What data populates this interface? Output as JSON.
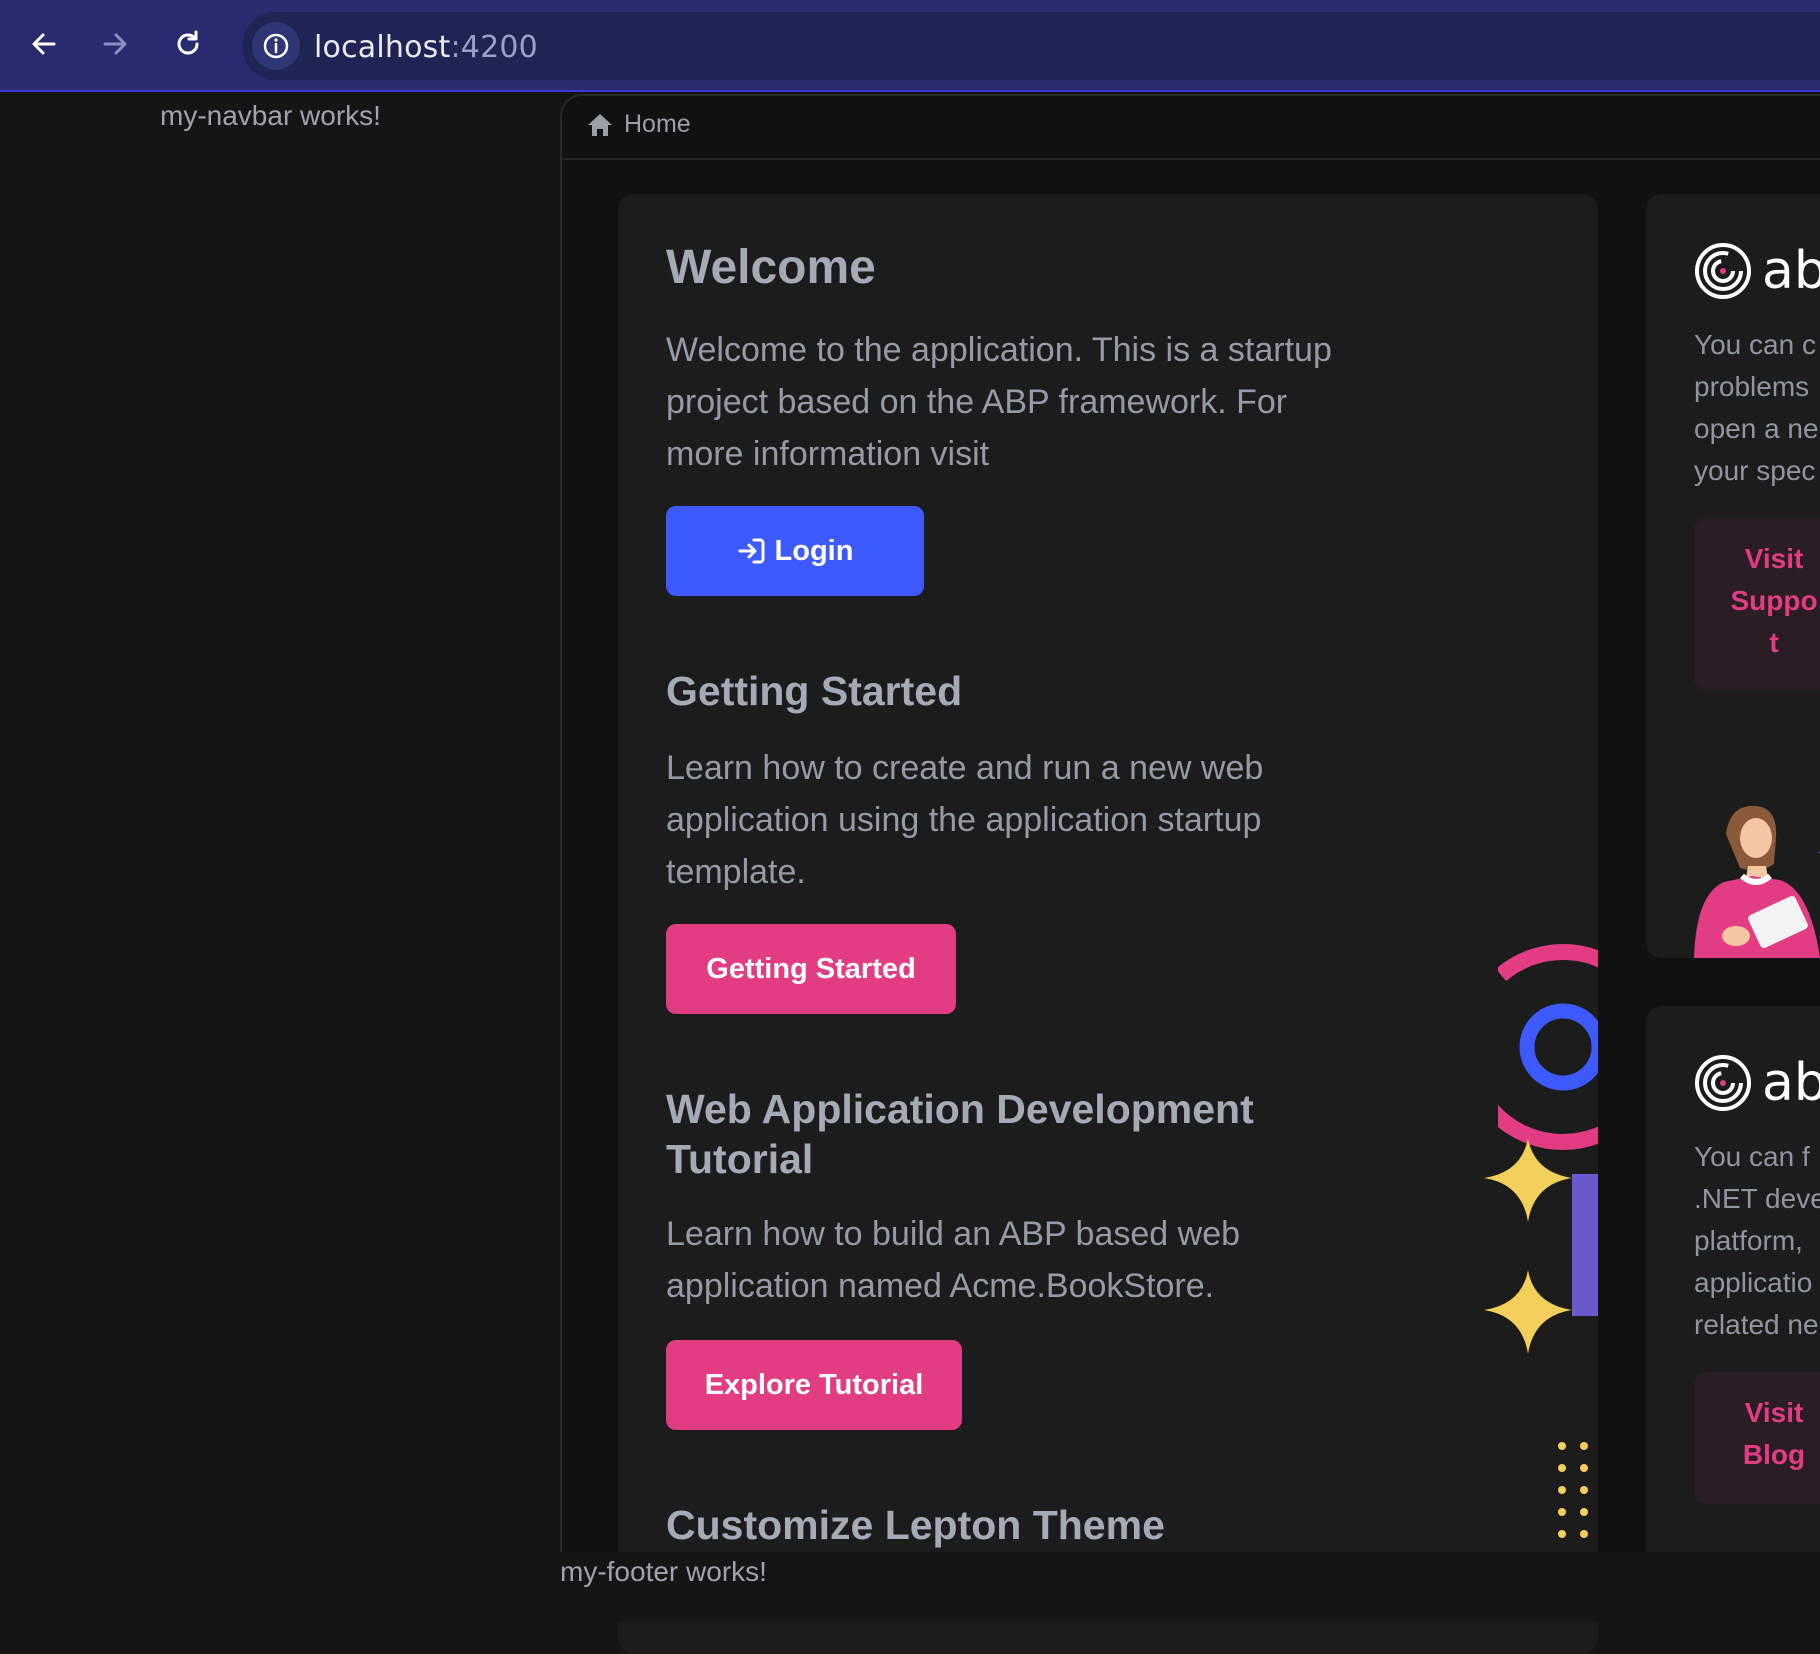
{
  "browser": {
    "back_icon": "arrow-left-icon",
    "forward_icon": "arrow-right-icon",
    "reload_icon": "reload-icon",
    "site_info_icon": "info-icon",
    "url_host": "localhost",
    "url_port": ":4200"
  },
  "navbar": {
    "text": "my-navbar works!"
  },
  "breadcrumb": {
    "icon": "home-icon",
    "label": "Home"
  },
  "welcome": {
    "title": "Welcome",
    "text_lines": [
      "Welcome to the application. This is a startup",
      "project based on the ABP framework. For",
      "more information visit"
    ],
    "login_label": "Login",
    "login_icon": "login-icon"
  },
  "getting_started": {
    "title": "Getting Started",
    "text_lines": [
      "Learn how to create and run a new web",
      "application using the application startup",
      "template."
    ],
    "button_label": "Getting Started"
  },
  "tutorial": {
    "title_lines": [
      "Web Application Development",
      "Tutorial"
    ],
    "text_lines": [
      "Learn how to build an ABP based web",
      "application named Acme.BookStore."
    ],
    "button_label": "Explore Tutorial"
  },
  "customize": {
    "title": "Customize Lepton Theme"
  },
  "support_card": {
    "logo_text": "ab",
    "text_lines": [
      "You can c",
      "problems",
      "open a ne",
      "your spec"
    ],
    "button_lines": [
      "Visit",
      "Suppo",
      "t"
    ]
  },
  "blog_card": {
    "logo_text": "ab",
    "text_lines": [
      "You can f",
      ".NET deve",
      "platform,",
      "applicatio",
      "related ne"
    ],
    "button_lines": [
      "Visit",
      "Blog"
    ]
  },
  "footer": {
    "text": "my-footer works!"
  },
  "colors": {
    "primary": "#3d5afe",
    "pink": "#e23c83",
    "yellow": "#f2cf5b",
    "purple": "#6a5acd"
  }
}
